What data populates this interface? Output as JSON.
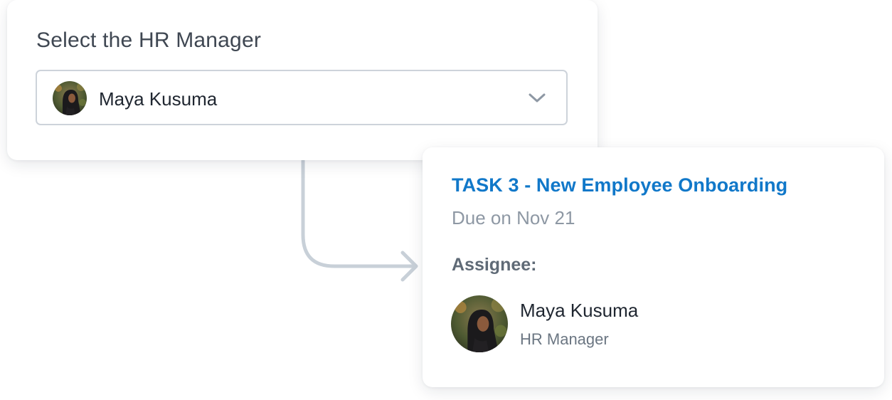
{
  "selector": {
    "label": "Select the HR Manager",
    "selected_value": "Maya Kusuma",
    "avatar_icon": "user-avatar-photo",
    "dropdown_icon": "chevron-down-icon"
  },
  "connector": {
    "icon": "arrow-right-icon",
    "color": "#c8d0d8"
  },
  "task": {
    "title": "TASK 3 - New Employee Onboarding",
    "due": "Due on Nov 21",
    "assignee_label": "Assignee:",
    "assignee": {
      "name": "Maya Kusuma",
      "role": "HR Manager",
      "avatar_icon": "user-avatar-photo"
    }
  },
  "colors": {
    "accent": "#1178c9",
    "border": "#cdd3da",
    "muted_text": "#8e98a4"
  }
}
